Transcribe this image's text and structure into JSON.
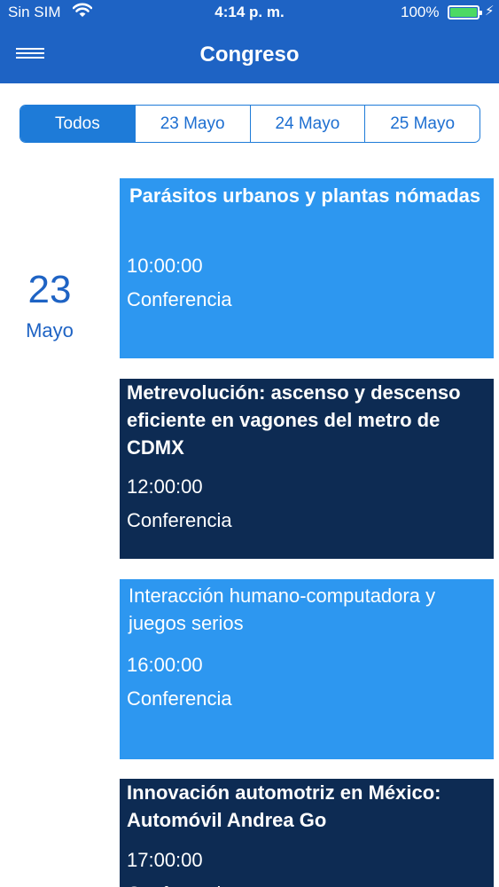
{
  "status_bar": {
    "carrier": "Sin SIM",
    "time": "4:14 p. m.",
    "battery": "100%",
    "wifi_icon": "wifi-icon",
    "battery_icon": "battery-icon",
    "charging_icon": "bolt-icon"
  },
  "nav": {
    "title": "Congreso",
    "menu_icon": "hamburger-menu-icon"
  },
  "tabs": [
    {
      "label": "Todos",
      "selected": true
    },
    {
      "label": "23 Mayo",
      "selected": false
    },
    {
      "label": "24 Mayo",
      "selected": false
    },
    {
      "label": "25 Mayo",
      "selected": false
    }
  ],
  "date_group": {
    "day": "23",
    "month": "Mayo"
  },
  "events": [
    {
      "title": "Parásitos urbanos y plantas nómadas",
      "time": "10:00:00",
      "type": "Conferencia",
      "style": "light"
    },
    {
      "title": "Metrevolución: ascenso y descenso eficiente en vagones del metro de CDMX",
      "time": "12:00:00",
      "type": "Conferencia",
      "style": "dark"
    },
    {
      "title": "Interacción humano-computadora y juegos serios",
      "time": "16:00:00",
      "type": "Conferencia",
      "style": "light"
    },
    {
      "title": "Innovación automotriz en México: Automóvil Andrea Go",
      "time": "17:00:00",
      "type": "Conferencia",
      "style": "dark"
    }
  ],
  "colors": {
    "header_blue": "#1e63c4",
    "segment_blue": "#1e7bd8",
    "card_light": "#2d97f0",
    "card_dark": "#0d2b53"
  }
}
